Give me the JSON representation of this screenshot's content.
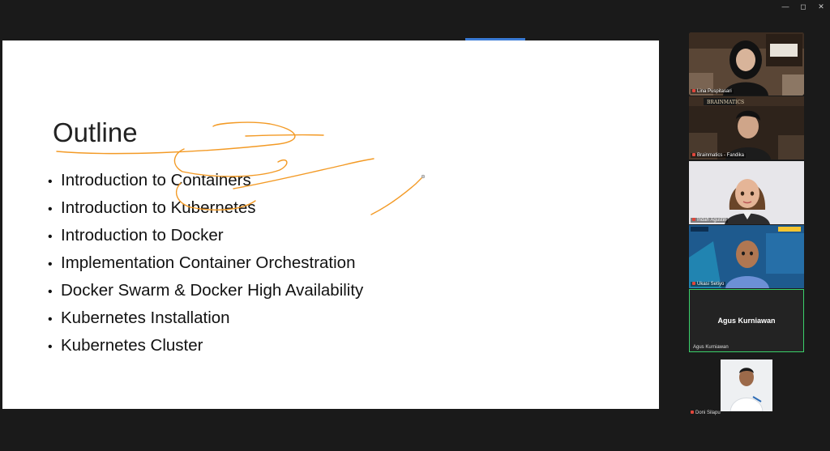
{
  "window": {
    "controls": [
      "—",
      "◻",
      "✕"
    ]
  },
  "slide": {
    "title": "Outline",
    "bullets": [
      "Introduction to Containers",
      "Introduction to Kubernetes",
      "Introduction to Docker",
      "Implementation Container Orchestration",
      "Docker Swarm & Docker High Availability",
      "Kubernetes Installation",
      "Kubernetes Cluster"
    ]
  },
  "participants": [
    {
      "name": "Lina Puspitasari",
      "icon": "person-hijab-video"
    },
    {
      "name": "Brainmatics - Fandika",
      "icon": "person-video"
    },
    {
      "name": "Indah Agustin",
      "icon": "female-avatar"
    },
    {
      "name": "Ukasi Setiyo",
      "icon": "male-avatar"
    },
    {
      "name": "Agus Kurniawan",
      "label": "Agus Kurniawan",
      "active_speaker": true
    },
    {
      "name": "Doni Silapu",
      "icon": "self-view-person"
    }
  ],
  "colors": {
    "ink": "#f39a25",
    "active_border": "#3ad06a",
    "share_bar": "#3a7bd5",
    "muted_icon": "#e0463b"
  }
}
